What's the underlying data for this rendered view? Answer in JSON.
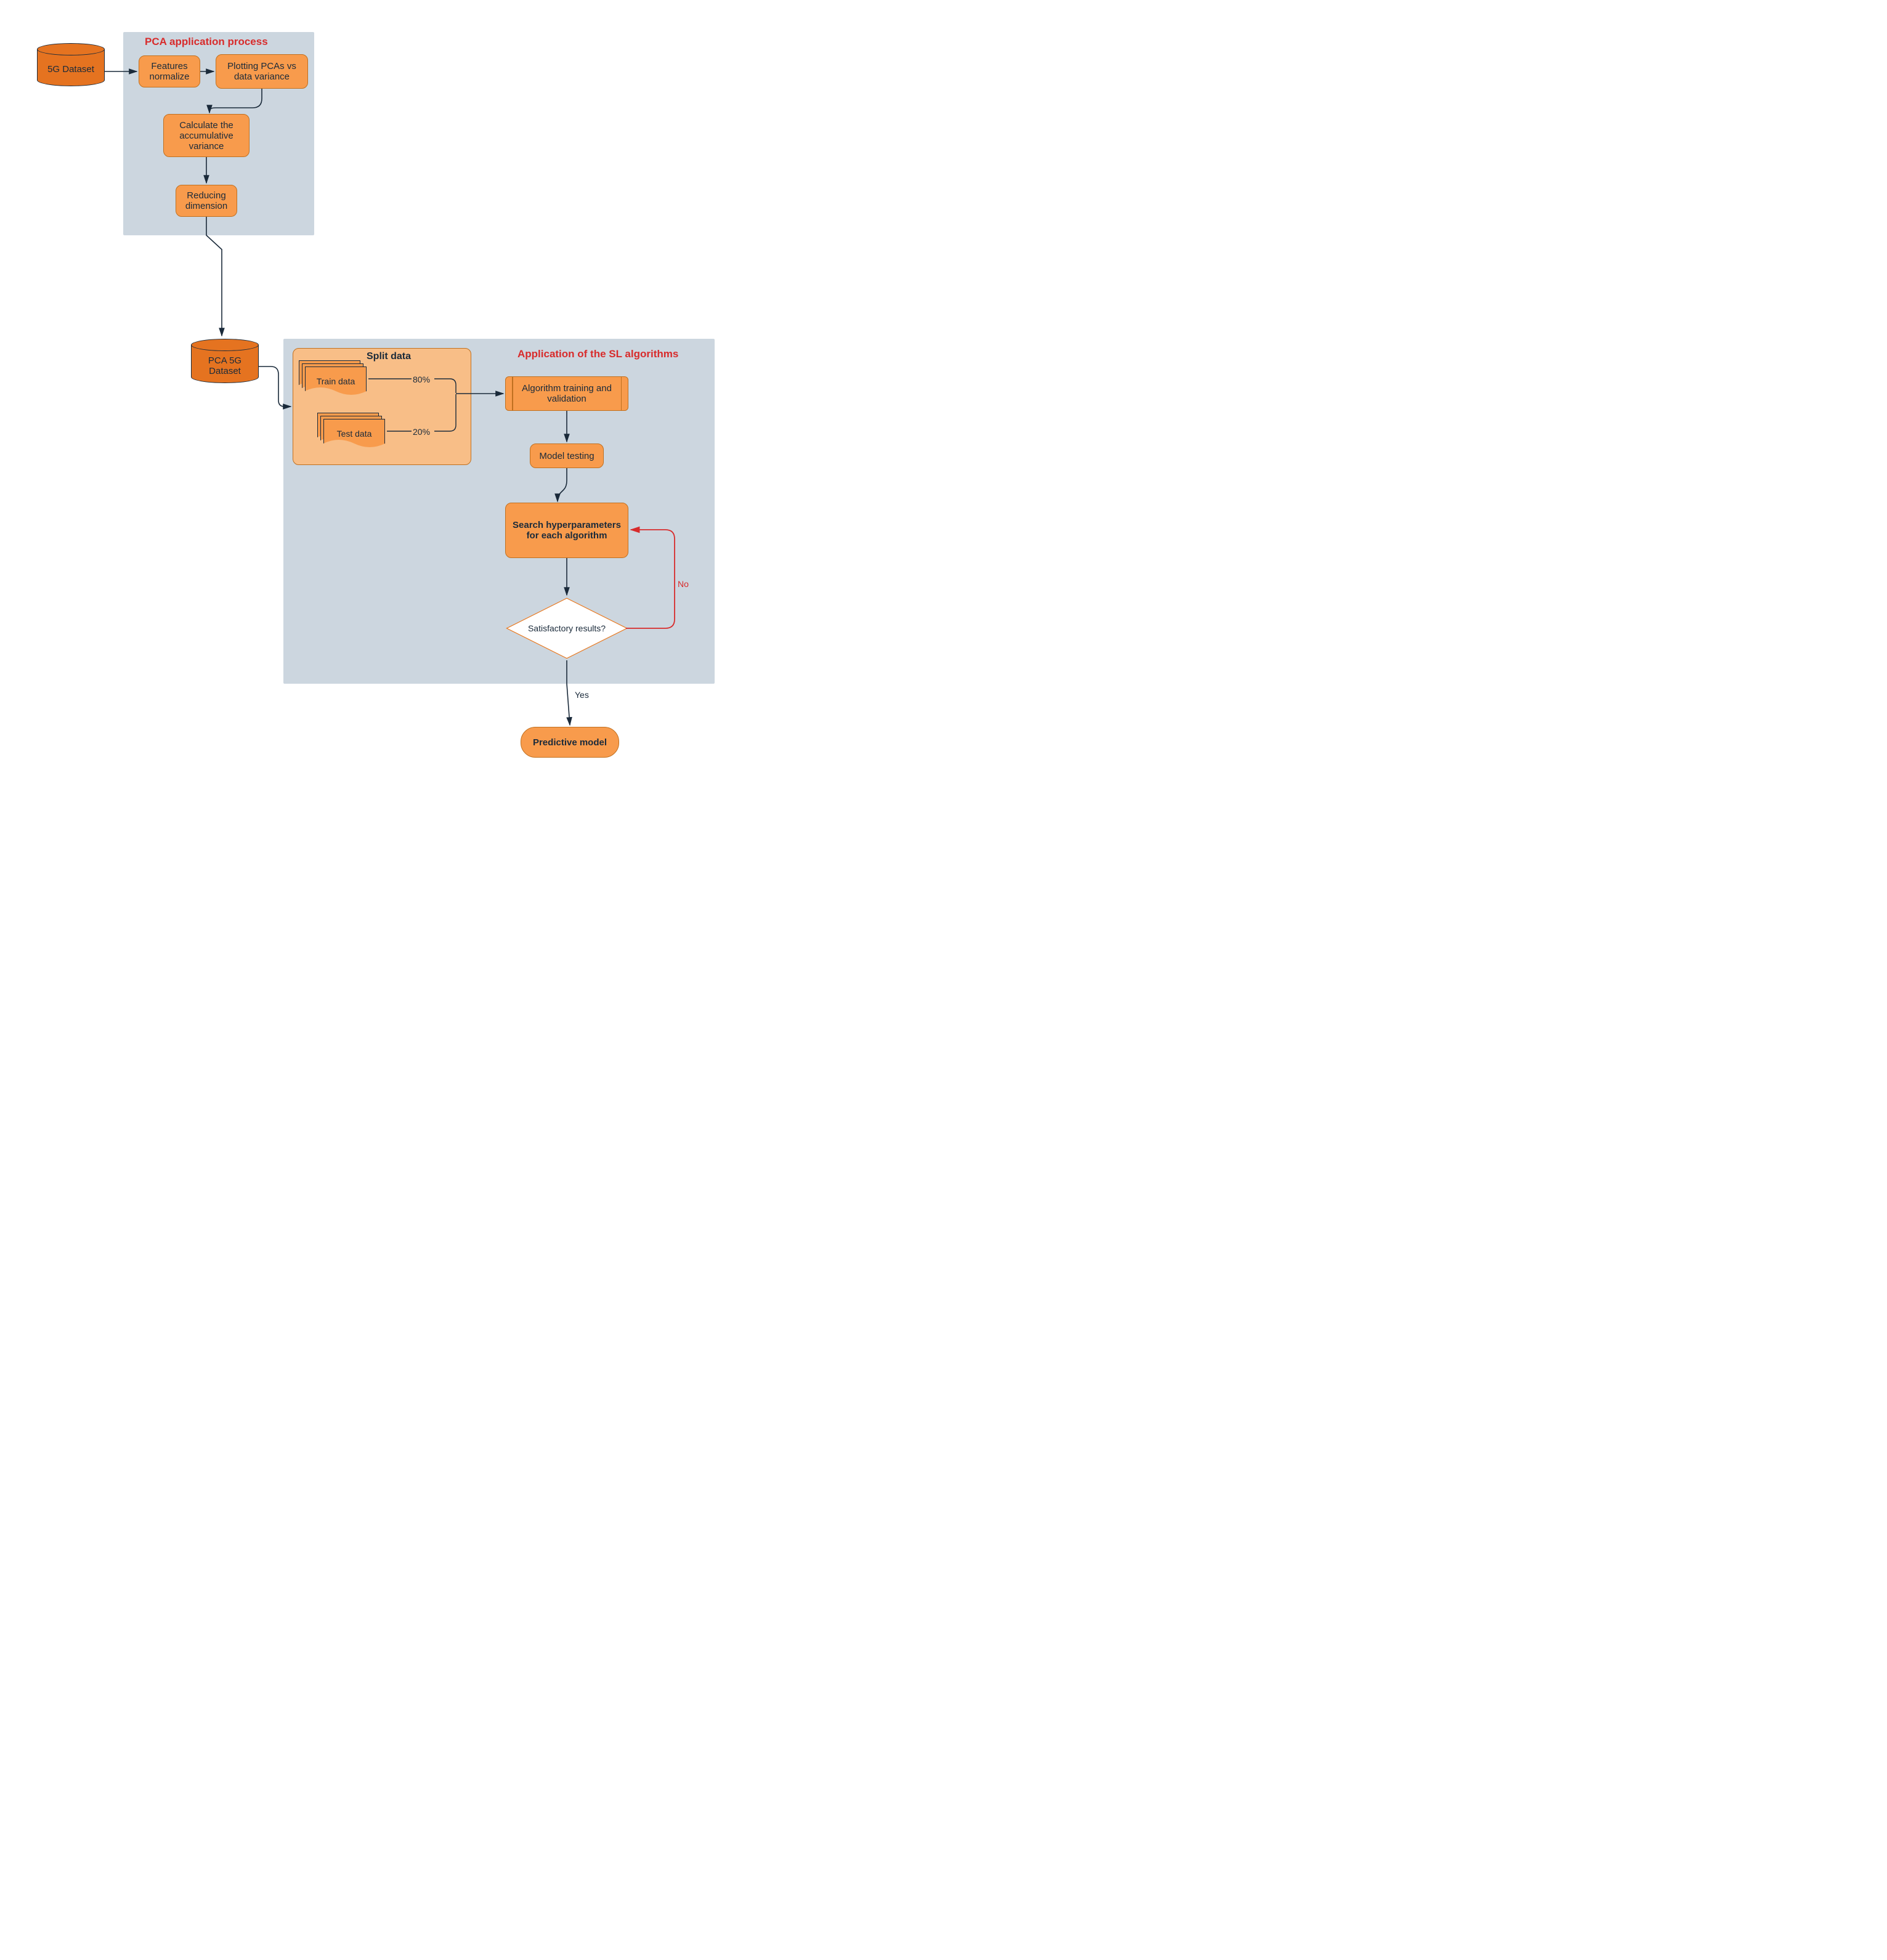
{
  "groups": {
    "pca": {
      "title": "PCA application process"
    },
    "sl": {
      "title": "Application of the SL algorithms"
    }
  },
  "nodes": {
    "dataset5g": {
      "label": "5G Dataset"
    },
    "normalize": {
      "label": "Features normalize"
    },
    "plot": {
      "label": "Plotting PCAs vs data variance"
    },
    "cumvar": {
      "label": "Calculate the accumulative variance"
    },
    "reduce": {
      "label": "Reducing dimension"
    },
    "pca5g": {
      "label": "PCA 5G Dataset"
    },
    "splitTitle": {
      "label": "Split data"
    },
    "train": {
      "label": "Train data"
    },
    "test": {
      "label": "Test data"
    },
    "trainPct": {
      "label": "80%"
    },
    "testPct": {
      "label": "20%"
    },
    "algTrain": {
      "label": "Algorithm training and validation"
    },
    "modelTest": {
      "label": "Model testing"
    },
    "hyper": {
      "label": "Search hyperparameters for each algorithm"
    },
    "decision": {
      "label": "Satisfactory results?"
    },
    "yes": {
      "label": "Yes"
    },
    "no": {
      "label": "No"
    },
    "predictive": {
      "label": "Predictive model"
    }
  }
}
